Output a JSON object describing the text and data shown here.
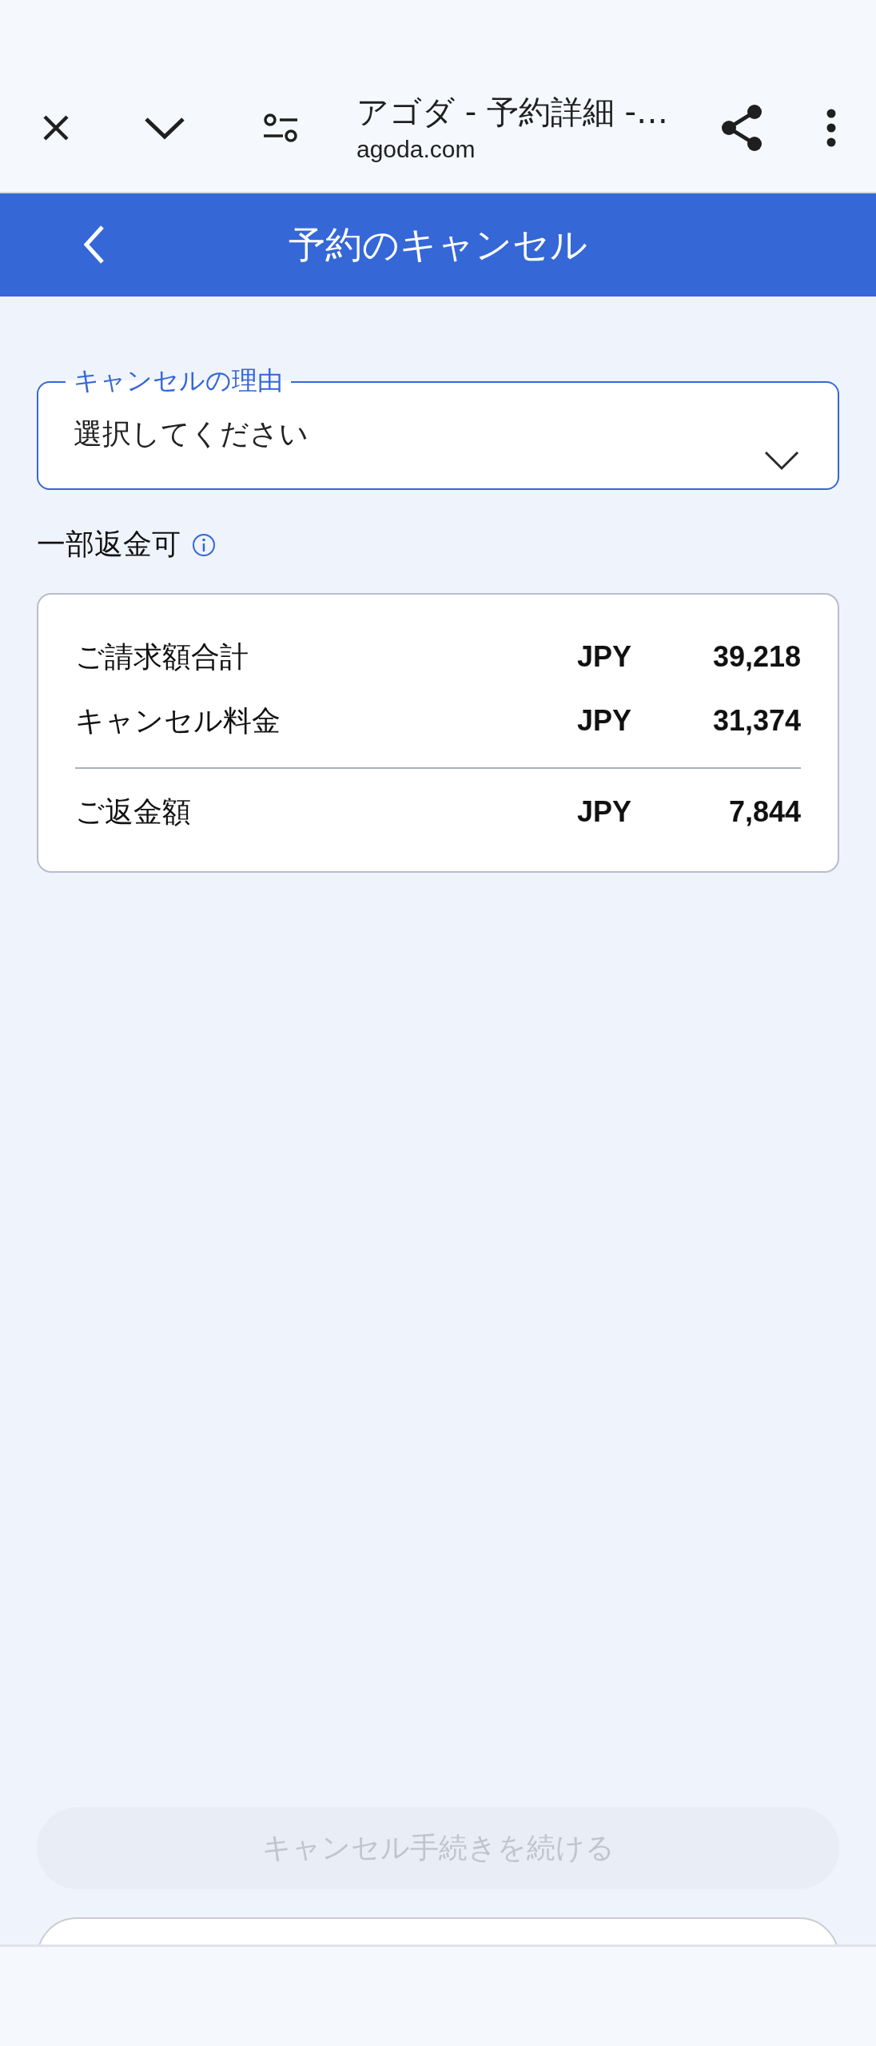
{
  "browser": {
    "title": "アゴダ - 予約詳細 -…",
    "url": "agoda.com"
  },
  "header": {
    "title": "予約のキャンセル"
  },
  "reason_field": {
    "label": "キャンセルの理由",
    "placeholder": "選択してください"
  },
  "refund_status": "一部返金可",
  "summary": {
    "rows": [
      {
        "label": "ご請求額合計",
        "currency": "JPY",
        "amount": "39,218"
      },
      {
        "label": "キャンセル料金",
        "currency": "JPY",
        "amount": "31,374"
      }
    ],
    "total": {
      "label": "ご返金額",
      "currency": "JPY",
      "amount": "7,844"
    }
  },
  "continue_button": {
    "label": "キャンセル手続きを続ける",
    "disabled": true
  }
}
